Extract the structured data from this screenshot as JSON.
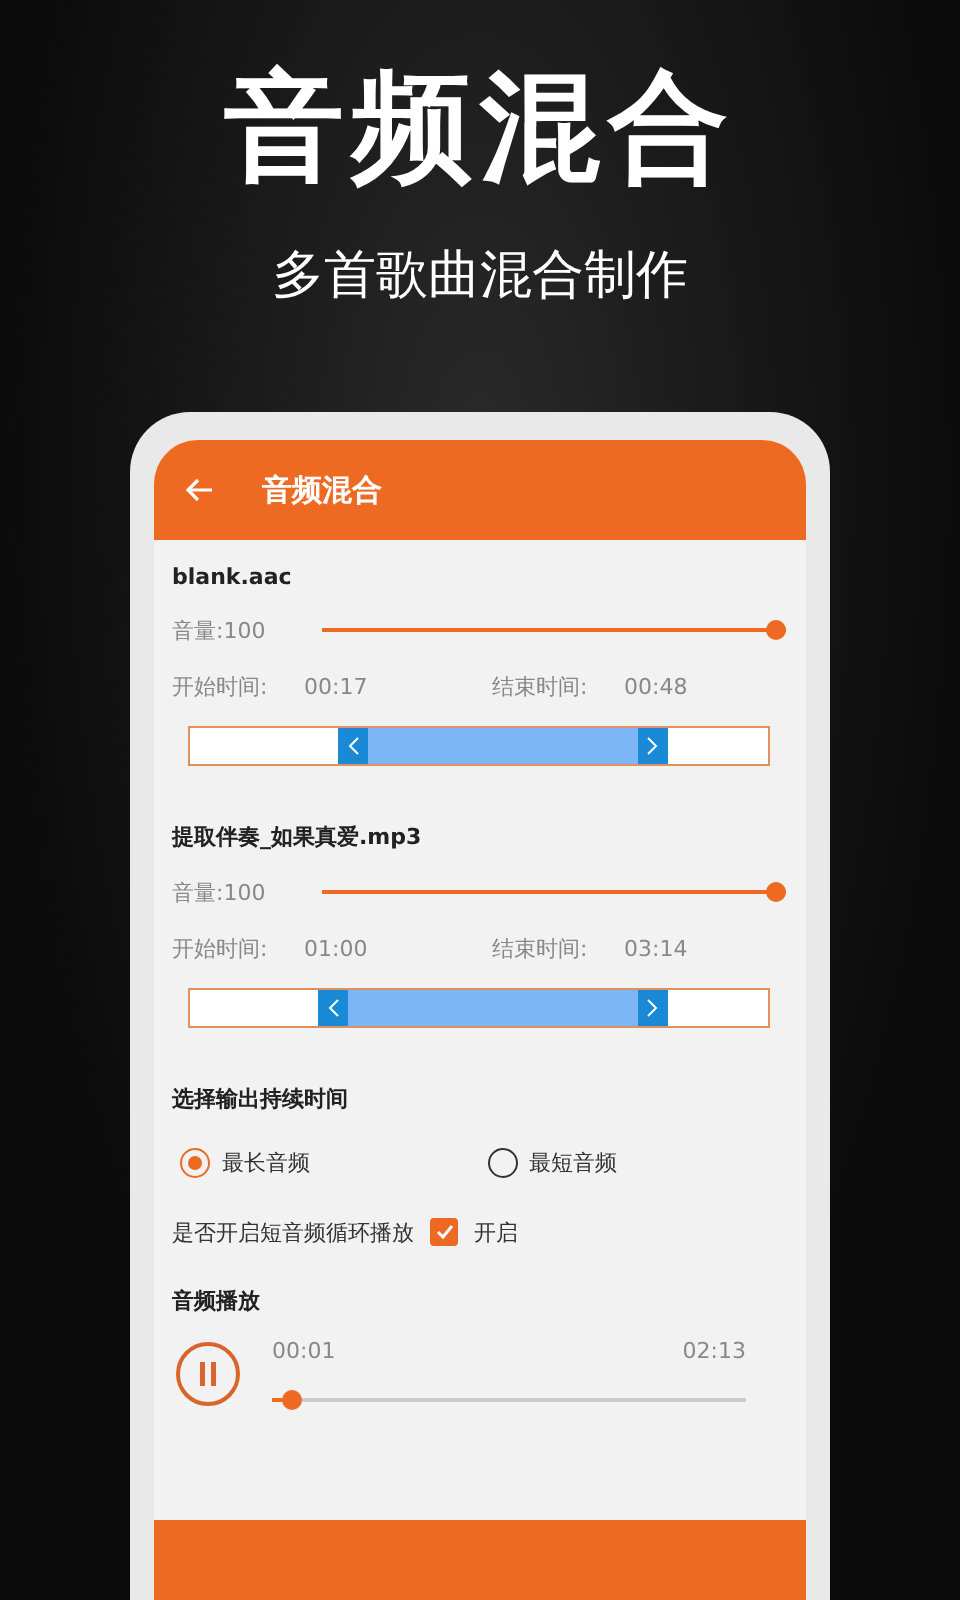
{
  "headline": "音频混合",
  "subtitle": "多首歌曲混合制作",
  "app_bar": {
    "title": "音频混合"
  },
  "tracks": [
    {
      "file": "blank.aac",
      "volume_label": "音量:100",
      "volume": {
        "level": 1
      },
      "start_label": "开始时间:",
      "start": "00:17",
      "end_label": "结束时间:",
      "end": "00:48",
      "handles": [
        {
          "level": 0.257
        },
        {
          "level": 0.826
        }
      ]
    },
    {
      "file": "提取伴奏_如果真爱.mp3",
      "volume_label": "音量:100",
      "volume": {
        "level": 1
      },
      "start_label": "开始时间:",
      "start": "01:00",
      "end_label": "结束时间:",
      "end": "03:14",
      "handles": [
        {
          "level": 0.222
        },
        {
          "level": 0.826
        }
      ]
    }
  ],
  "duration": {
    "title": "选择输出持续时间",
    "options": [
      {
        "label": "最长音频",
        "selected": true
      },
      {
        "label": "最短音频",
        "selected": false
      }
    ]
  },
  "loop": {
    "label": "是否开启短音频循环播放",
    "checkbox": {
      "label": "开启",
      "checked": true
    }
  },
  "player": {
    "title": "音频播放",
    "playing": true,
    "elapsed": "00:01",
    "total": "02:13",
    "progress": {
      "level": 0.02
    }
  }
}
